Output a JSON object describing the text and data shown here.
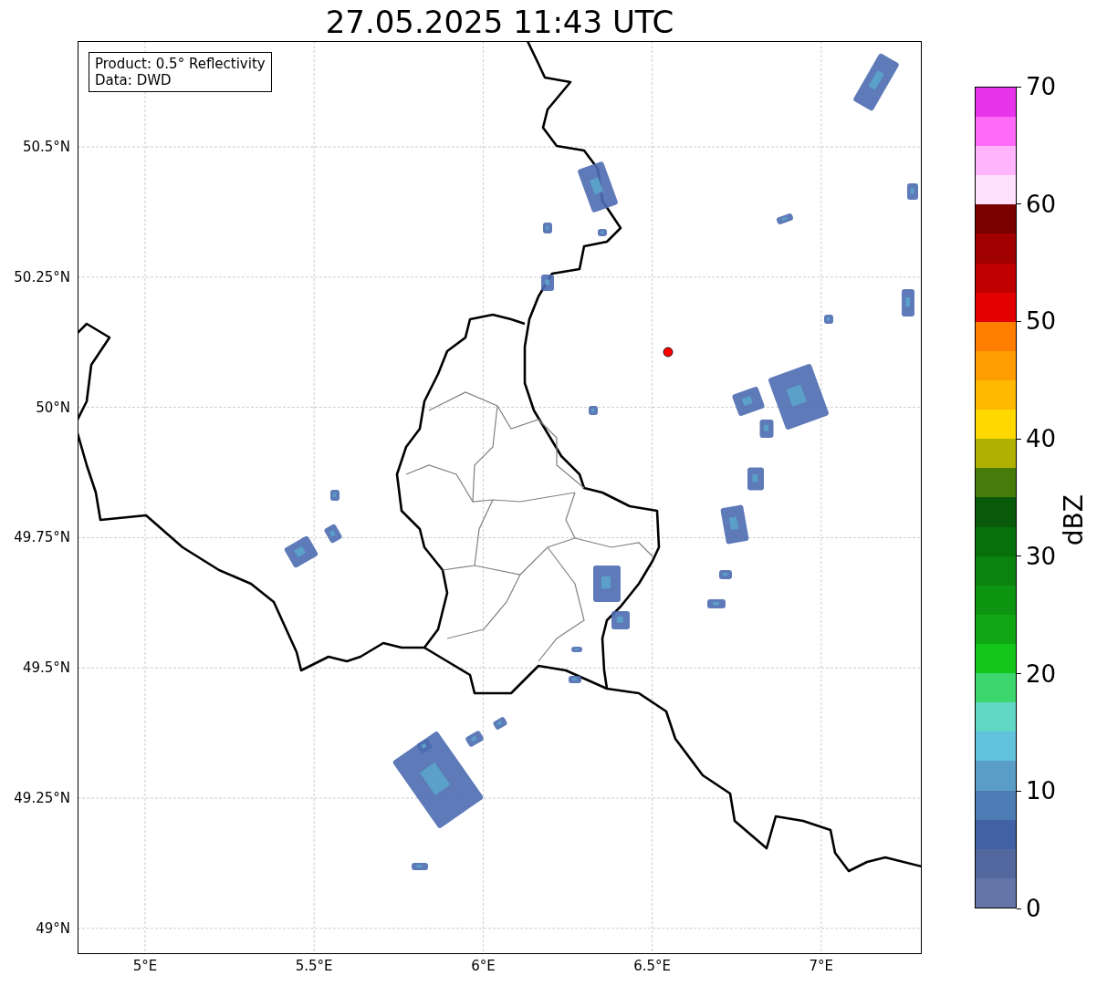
{
  "title": "27.05.2025 11:43 UTC",
  "legend": {
    "lines": [
      "Product: 0.5° Reflectivity",
      "Data: DWD"
    ]
  },
  "map": {
    "lat_labels": [
      "50.5°N",
      "50.25°N",
      "50°N",
      "49.75°N",
      "49.5°N",
      "49.25°N",
      "49°N"
    ],
    "lon_labels": [
      "5°E",
      "5.5°E",
      "6°E",
      "6.5°E",
      "7°E"
    ]
  },
  "colorbar": {
    "label": "dBZ",
    "tick_labels": [
      "70",
      "60",
      "50",
      "40",
      "30",
      "20",
      "10",
      "0"
    ],
    "segments": [
      {
        "color": "#6575a8"
      },
      {
        "color": "#5468a0"
      },
      {
        "color": "#4260a4"
      },
      {
        "color": "#4d7cb4"
      },
      {
        "color": "#5a9ec8"
      },
      {
        "color": "#62c2dc"
      },
      {
        "color": "#60d8c4"
      },
      {
        "color": "#3dd56e"
      },
      {
        "color": "#12c61a"
      },
      {
        "color": "#10a614"
      },
      {
        "color": "#0d9410"
      },
      {
        "color": "#0c830f"
      },
      {
        "color": "#08700b"
      },
      {
        "color": "#085a0a"
      },
      {
        "color": "#457c0a"
      },
      {
        "color": "#b0b000"
      },
      {
        "color": "#ffd800"
      },
      {
        "color": "#ffb900"
      },
      {
        "color": "#ff9d00"
      },
      {
        "color": "#ff7e00"
      },
      {
        "color": "#e20000"
      },
      {
        "color": "#c00000"
      },
      {
        "color": "#a00000"
      },
      {
        "color": "#7b0000"
      },
      {
        "color": "#ffe0fd"
      },
      {
        "color": "#ffb4fc"
      },
      {
        "color": "#ff6af8"
      },
      {
        "color": "#e934ec"
      }
    ]
  }
}
